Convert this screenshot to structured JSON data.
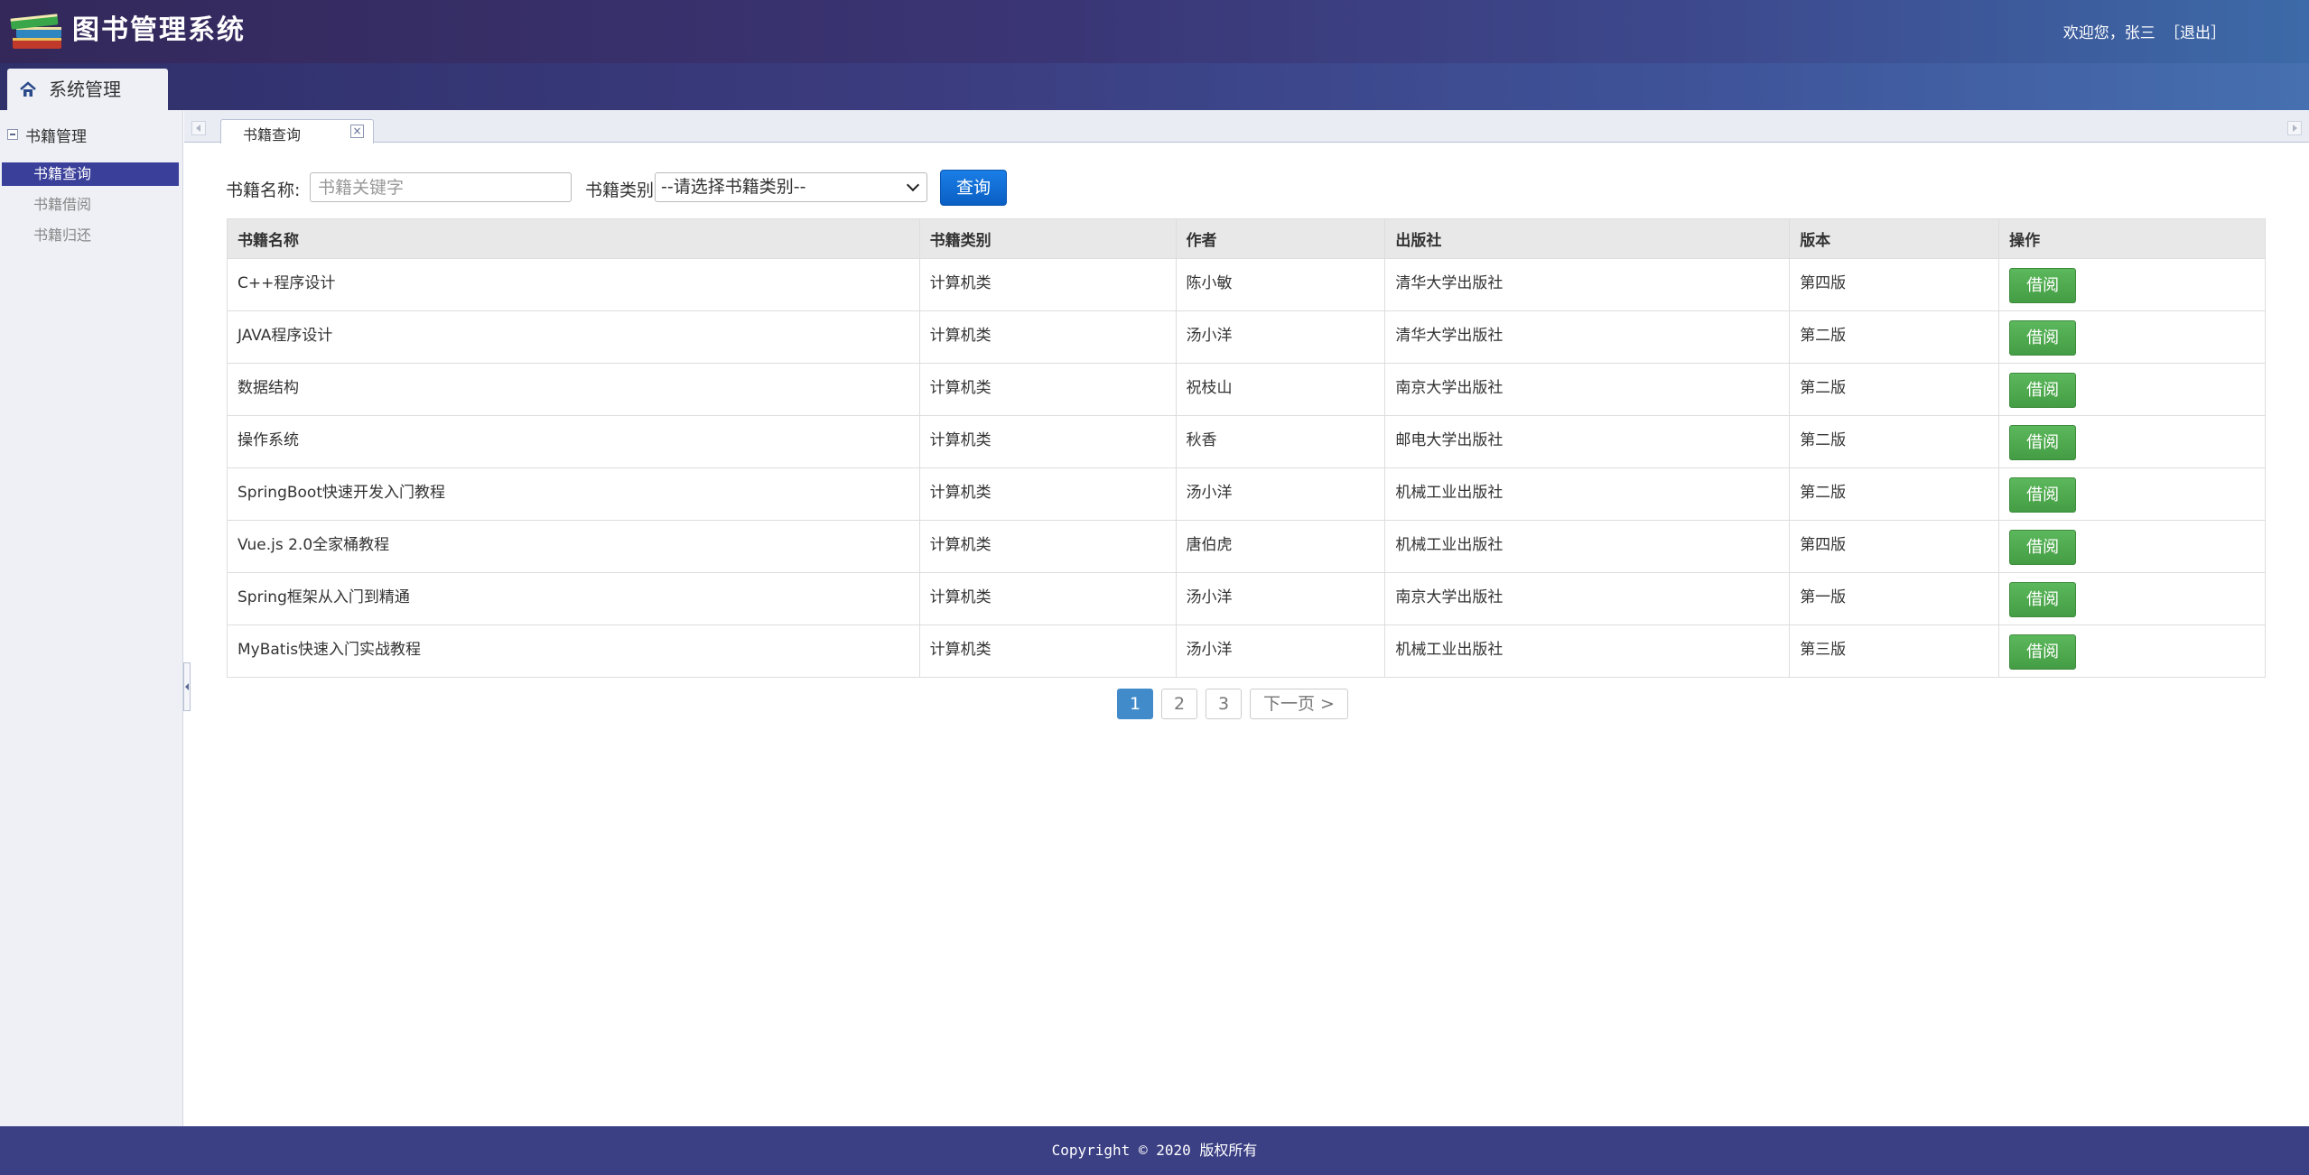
{
  "header": {
    "app_title": "图书管理系统",
    "welcome": "欢迎您，张三",
    "logout": "［退出］",
    "main_tab": "系统管理"
  },
  "sidebar": {
    "group_label": "书籍管理",
    "items": [
      {
        "label": "书籍查询",
        "active": true
      },
      {
        "label": "书籍借阅",
        "active": false
      },
      {
        "label": "书籍归还",
        "active": false
      }
    ]
  },
  "content_tab": {
    "label": "书籍查询",
    "close_glyph": "×"
  },
  "search": {
    "name_label": "书籍名称:",
    "name_placeholder": "书籍关键字",
    "type_label": "书籍类别:",
    "type_selected": "--请选择书籍类别--",
    "query_button": "查询"
  },
  "table": {
    "columns": [
      "书籍名称",
      "书籍类别",
      "作者",
      "出版社",
      "版本",
      "操作"
    ],
    "rows": [
      {
        "name": "C++程序设计",
        "category": "计算机类",
        "author": "陈小敏",
        "publisher": "清华大学出版社",
        "edition": "第四版",
        "action": "借阅"
      },
      {
        "name": "JAVA程序设计",
        "category": "计算机类",
        "author": "汤小洋",
        "publisher": "清华大学出版社",
        "edition": "第二版",
        "action": "借阅"
      },
      {
        "name": "数据结构",
        "category": "计算机类",
        "author": "祝枝山",
        "publisher": "南京大学出版社",
        "edition": "第二版",
        "action": "借阅"
      },
      {
        "name": "操作系统",
        "category": "计算机类",
        "author": "秋香",
        "publisher": "邮电大学出版社",
        "edition": "第二版",
        "action": "借阅"
      },
      {
        "name": "SpringBoot快速开发入门教程",
        "category": "计算机类",
        "author": "汤小洋",
        "publisher": "机械工业出版社",
        "edition": "第二版",
        "action": "借阅"
      },
      {
        "name": "Vue.js 2.0全家桶教程",
        "category": "计算机类",
        "author": "唐伯虎",
        "publisher": "机械工业出版社",
        "edition": "第四版",
        "action": "借阅"
      },
      {
        "name": "Spring框架从入门到精通",
        "category": "计算机类",
        "author": "汤小洋",
        "publisher": "南京大学出版社",
        "edition": "第一版",
        "action": "借阅"
      },
      {
        "name": "MyBatis快速入门实战教程",
        "category": "计算机类",
        "author": "汤小洋",
        "publisher": "机械工业出版社",
        "edition": "第三版",
        "action": "借阅"
      }
    ]
  },
  "pagination": {
    "pages": [
      "1",
      "2",
      "3"
    ],
    "current": "1",
    "next": "下一页 >"
  },
  "footer": {
    "copyright": "Copyright © 2020 版权所有"
  },
  "colors": {
    "header": "#3a3575",
    "sidebar_active": "#3a3f9a",
    "query_button": "#0a6fd8",
    "borrow_button": "#4cae4c",
    "page_current": "#428bca",
    "footer": "#3b3f84"
  }
}
